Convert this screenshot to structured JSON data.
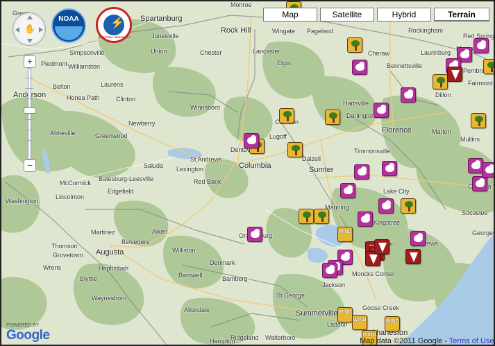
{
  "map_type_controls": [
    {
      "id": "map",
      "label": "Map",
      "active": false
    },
    {
      "id": "satellite",
      "label": "Satellite",
      "active": false
    },
    {
      "id": "hybrid",
      "label": "Hybrid",
      "active": false
    },
    {
      "id": "terrain",
      "label": "Terrain",
      "active": true
    }
  ],
  "zoom": {
    "in_label": "+",
    "out_label": "−"
  },
  "logos": [
    {
      "id": "noaa",
      "text": "NOAA"
    },
    {
      "id": "nws",
      "text": "NATIONAL WEATHER SERVICE"
    }
  ],
  "places": [
    {
      "name": "Spartanburg",
      "big": true
    },
    {
      "name": "Rock Hill",
      "big": true
    },
    {
      "name": "Greer"
    },
    {
      "name": "Jonesville"
    },
    {
      "name": "Simpsonville"
    },
    {
      "name": "Piedmont"
    },
    {
      "name": "Williamston"
    },
    {
      "name": "Belton"
    },
    {
      "name": "Anderson",
      "big": true
    },
    {
      "name": "Honea Path"
    },
    {
      "name": "Abbeville"
    },
    {
      "name": "Greenwood"
    },
    {
      "name": "McCormick"
    },
    {
      "name": "Lincolnton"
    },
    {
      "name": "Washington"
    },
    {
      "name": "Union"
    },
    {
      "name": "Laurens"
    },
    {
      "name": "Clinton"
    },
    {
      "name": "Chester"
    },
    {
      "name": "Lancaster"
    },
    {
      "name": "Elgin"
    },
    {
      "name": "Winnsboro"
    },
    {
      "name": "Newberry"
    },
    {
      "name": "Saluda"
    },
    {
      "name": "Batesburg-Leesville"
    },
    {
      "name": "Lexington"
    },
    {
      "name": "Edgefield"
    },
    {
      "name": "St Andrews"
    },
    {
      "name": "Columbia",
      "big": true
    },
    {
      "name": "Dentsville"
    },
    {
      "name": "Lugoff"
    },
    {
      "name": "Camden"
    },
    {
      "name": "Red Bank"
    },
    {
      "name": "Martinez"
    },
    {
      "name": "Aiken"
    },
    {
      "name": "Belvedere"
    },
    {
      "name": "Thomson"
    },
    {
      "name": "Grovetown"
    },
    {
      "name": "Augusta",
      "big": true
    },
    {
      "name": "Hephzibah"
    },
    {
      "name": "Wrens"
    },
    {
      "name": "Waynesboro"
    },
    {
      "name": "Blythe"
    },
    {
      "name": "Williston"
    },
    {
      "name": "Denmark"
    },
    {
      "name": "Barnwell"
    },
    {
      "name": "Bamberg"
    },
    {
      "name": "Orangeburg"
    },
    {
      "name": "Allendale"
    },
    {
      "name": "Hampton"
    },
    {
      "name": "Walterboro"
    },
    {
      "name": "St George"
    },
    {
      "name": "Summerville",
      "big": true
    },
    {
      "name": "Ladson"
    },
    {
      "name": "Goose Creek"
    },
    {
      "name": "Moncks Corner"
    },
    {
      "name": "Charleston",
      "big": true
    },
    {
      "name": "Sumter",
      "big": true
    },
    {
      "name": "Dalzell"
    },
    {
      "name": "Manning"
    },
    {
      "name": "Kingstree"
    },
    {
      "name": "Lake City"
    },
    {
      "name": "Timmonsville"
    },
    {
      "name": "Florence",
      "big": true
    },
    {
      "name": "Darlington"
    },
    {
      "name": "Hartsville"
    },
    {
      "name": "Bennettsville"
    },
    {
      "name": "Cheraw"
    },
    {
      "name": "Laurinburg"
    },
    {
      "name": "Maxton"
    },
    {
      "name": "Pembroke"
    },
    {
      "name": "Fairmont"
    },
    {
      "name": "Dillon"
    },
    {
      "name": "Marion"
    },
    {
      "name": "Mullins"
    },
    {
      "name": "Andrews"
    },
    {
      "name": "Socastee"
    },
    {
      "name": "Carolina Forest"
    },
    {
      "name": "Georgetown"
    },
    {
      "name": "Red Springs"
    },
    {
      "name": "Monroe"
    },
    {
      "name": "Wingate"
    },
    {
      "name": "Pageland"
    },
    {
      "name": "St Stephen"
    },
    {
      "name": "Rockingham"
    },
    {
      "name": "Jackson"
    },
    {
      "name": "Ridgeland"
    }
  ],
  "markers": [
    {
      "type": "tree"
    },
    {
      "type": "tree"
    },
    {
      "type": "tree"
    },
    {
      "type": "tree"
    },
    {
      "type": "tree"
    },
    {
      "type": "tree"
    },
    {
      "type": "tree"
    },
    {
      "type": "tree"
    },
    {
      "type": "tree"
    },
    {
      "type": "tree"
    },
    {
      "type": "tree"
    },
    {
      "type": "tree"
    },
    {
      "type": "hail"
    },
    {
      "type": "hail"
    },
    {
      "type": "hail"
    },
    {
      "type": "hail"
    },
    {
      "type": "hail"
    },
    {
      "type": "hail"
    },
    {
      "type": "hail"
    },
    {
      "type": "hail"
    },
    {
      "type": "hail"
    },
    {
      "type": "hail"
    },
    {
      "type": "hail"
    },
    {
      "type": "hail"
    },
    {
      "type": "hail"
    },
    {
      "type": "hail"
    },
    {
      "type": "hail"
    },
    {
      "type": "hail"
    },
    {
      "type": "hail"
    },
    {
      "type": "hail"
    },
    {
      "type": "hail"
    },
    {
      "type": "hail"
    },
    {
      "type": "tornado"
    },
    {
      "type": "tornado"
    },
    {
      "type": "tornado"
    },
    {
      "type": "tornado"
    },
    {
      "type": "tornado"
    },
    {
      "type": "tornado"
    },
    {
      "type": "wind",
      "label": "WIND"
    },
    {
      "type": "wind",
      "label": "WIND"
    },
    {
      "type": "wind",
      "label": "WIND"
    },
    {
      "type": "wind",
      "label": "WIND"
    },
    {
      "type": "wind",
      "label": "WIND"
    }
  ],
  "footer": {
    "powered_by": "POWERED BY",
    "google": "Google",
    "map_data": "Map data ©2011 Google -",
    "terms": "Terms of Use"
  },
  "colors": {
    "terrain_base": "#dfe6cf",
    "forest": "#a9c593",
    "water": "#aacbe8",
    "tree_marker": "#e8b832",
    "hail_marker": "#b3329b",
    "tornado_marker": "#a11c1c"
  }
}
